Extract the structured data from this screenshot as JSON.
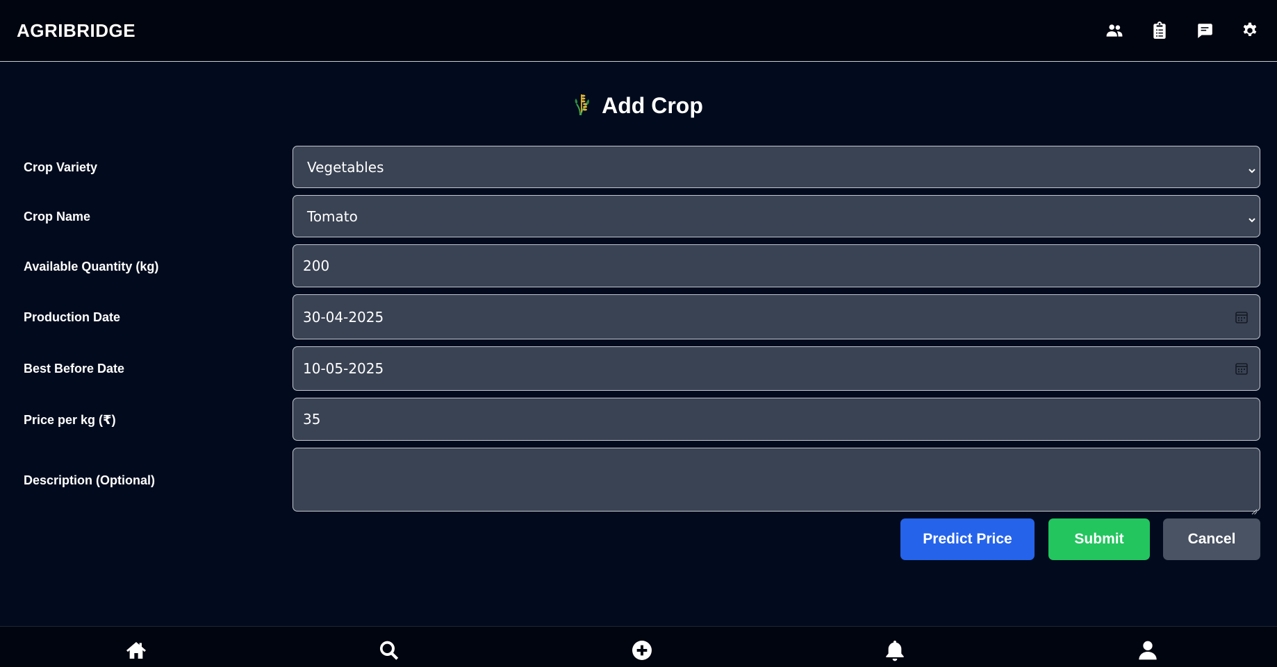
{
  "app": {
    "brand": "AGRIBRIDGE"
  },
  "header_icons": [
    "users-icon",
    "clipboard-icon",
    "chat-icon",
    "gear-icon"
  ],
  "page": {
    "title": "Add Crop",
    "title_icon": "wheat-plant-icon"
  },
  "form": {
    "crop_variety": {
      "label": "Crop Variety",
      "value": "Vegetables"
    },
    "crop_name": {
      "label": "Crop Name",
      "value": "Tomato"
    },
    "quantity": {
      "label": "Available Quantity (kg)",
      "value": "200"
    },
    "production_date": {
      "label": "Production Date",
      "value": "30-04-2025"
    },
    "best_before": {
      "label": "Best Before Date",
      "value": "10-05-2025"
    },
    "price": {
      "label": "Price per kg (₹)",
      "value": "35"
    },
    "description": {
      "label": "Description (Optional)",
      "value": ""
    }
  },
  "buttons": {
    "predict": "Predict Price",
    "submit": "Submit",
    "cancel": "Cancel"
  },
  "bottom_nav": [
    "home-icon",
    "search-icon",
    "add-circle-icon",
    "bell-icon",
    "profile-icon"
  ],
  "colors": {
    "background": "#020b1d",
    "field": "#3a4353",
    "predict": "#2563eb",
    "submit": "#22c55e",
    "cancel": "#4a5363"
  }
}
